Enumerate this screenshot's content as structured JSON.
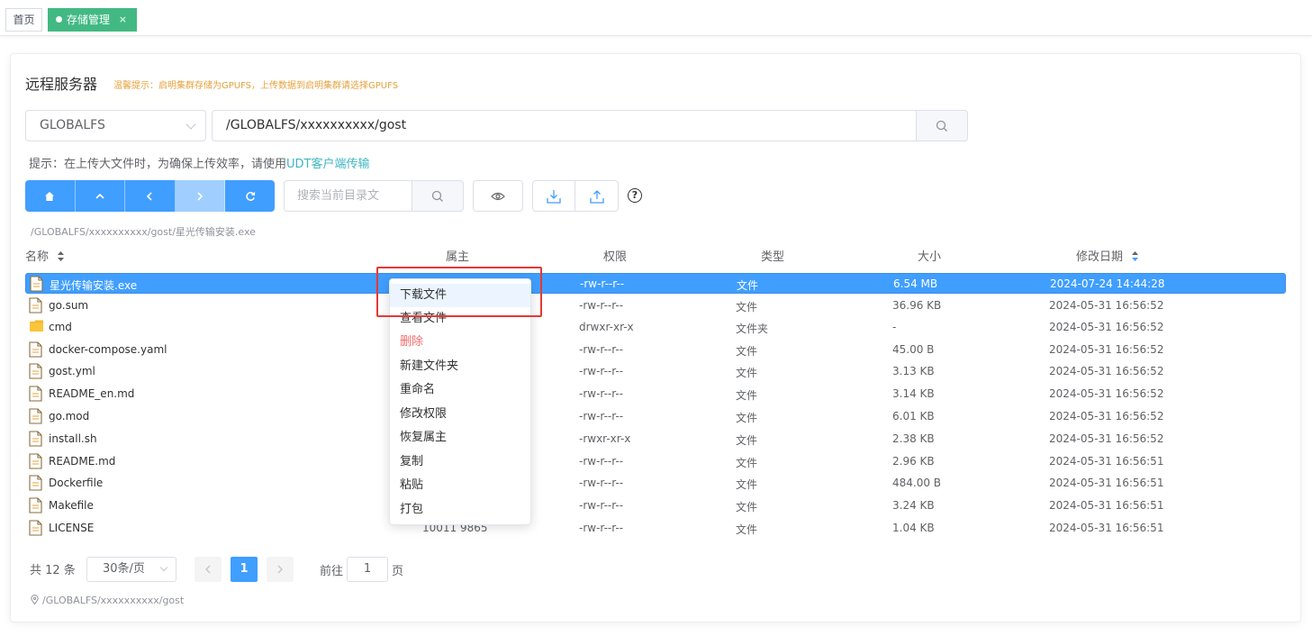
{
  "tabs": {
    "home_label": "首页",
    "active_label": "存储管理",
    "close_glyph": "×"
  },
  "panel": {
    "title": "远程服务器",
    "warning": "温馨提示：启明集群存储为GPUFS，上传数据到启明集群请选择GPUFS"
  },
  "pathbar": {
    "filesystem": "GLOBALFS",
    "path": "/GLOBALFS/xxxxxxxxxx/gost"
  },
  "hint": {
    "prefix": "提示：在上传大文件时，为确保上传效率，请使用",
    "link": "UDT客户端传输"
  },
  "toolbar": {
    "search_placeholder": "搜索当前目录文",
    "help_glyph": "?",
    "icons": [
      "home-icon",
      "arrow-up-icon",
      "arrow-left-icon",
      "arrow-right-icon",
      "refresh-icon",
      "search-icon",
      "eye-icon",
      "download-icon",
      "upload-icon",
      "help-icon"
    ]
  },
  "current_selection_path": "/GLOBALFS/xxxxxxxxxx/gost/星光传输安装.exe",
  "table": {
    "columns": [
      "名称",
      "属主",
      "权限",
      "类型",
      "大小",
      "修改日期"
    ],
    "rows": [
      {
        "name": "星光传输安装.exe",
        "owner": "",
        "perm": "-rw-r--r--",
        "type": "文件",
        "size": "6.54 MB",
        "date": "2024-07-24 14:44:28",
        "icon": "file-icon",
        "selected": true
      },
      {
        "name": "go.sum",
        "owner": "",
        "perm": "-rw-r--r--",
        "type": "文件",
        "size": "36.96 KB",
        "date": "2024-05-31 16:56:52",
        "icon": "file-icon"
      },
      {
        "name": "cmd",
        "owner": "",
        "perm": "drwxr-xr-x",
        "type": "文件夹",
        "size": "-",
        "date": "2024-05-31 16:56:52",
        "icon": "folder-icon"
      },
      {
        "name": "docker-compose.yaml",
        "owner": "",
        "perm": "-rw-r--r--",
        "type": "文件",
        "size": "45.00 B",
        "date": "2024-05-31 16:56:52",
        "icon": "file-icon"
      },
      {
        "name": "gost.yml",
        "owner": "",
        "perm": "-rw-r--r--",
        "type": "文件",
        "size": "3.13 KB",
        "date": "2024-05-31 16:56:52",
        "icon": "file-icon"
      },
      {
        "name": "README_en.md",
        "owner": "",
        "perm": "-rw-r--r--",
        "type": "文件",
        "size": "3.14 KB",
        "date": "2024-05-31 16:56:52",
        "icon": "file-icon"
      },
      {
        "name": "go.mod",
        "owner": "",
        "perm": "-rw-r--r--",
        "type": "文件",
        "size": "6.01 KB",
        "date": "2024-05-31 16:56:52",
        "icon": "file-icon"
      },
      {
        "name": "install.sh",
        "owner": "",
        "perm": "-rwxr-xr-x",
        "type": "文件",
        "size": "2.38 KB",
        "date": "2024-05-31 16:56:52",
        "icon": "file-icon"
      },
      {
        "name": "README.md",
        "owner": "",
        "perm": "-rw-r--r--",
        "type": "文件",
        "size": "2.96 KB",
        "date": "2024-05-31 16:56:51",
        "icon": "file-icon"
      },
      {
        "name": "Dockerfile",
        "owner": "",
        "perm": "-rw-r--r--",
        "type": "文件",
        "size": "484.00 B",
        "date": "2024-05-31 16:56:51",
        "icon": "file-icon"
      },
      {
        "name": "Makefile",
        "owner": "",
        "perm": "-rw-r--r--",
        "type": "文件",
        "size": "3.24 KB",
        "date": "2024-05-31 16:56:51",
        "icon": "file-icon"
      },
      {
        "name": "LICENSE",
        "owner": "10011 9865",
        "perm": "-rw-r--r--",
        "type": "文件",
        "size": "1.04 KB",
        "date": "2024-05-31 16:56:51",
        "icon": "file-icon"
      }
    ]
  },
  "pagination": {
    "total": "共 12 条",
    "page_size": "30条/页",
    "current_page": "1",
    "goto_prefix": "前往",
    "goto_value": "1",
    "goto_suffix": "页"
  },
  "footer_path": "/GLOBALFS/xxxxxxxxxx/gost",
  "context_menu": {
    "items": [
      "下载文件",
      "查看文件",
      "删除",
      "新建文件夹",
      "重命名",
      "修改权限",
      "恢复属主",
      "复制",
      "粘贴",
      "打包"
    ],
    "hovered_index": 0,
    "danger_index": 2
  },
  "colors": {
    "primary": "#409eff",
    "tab_active": "#42b983",
    "warning": "#e6a23c",
    "danger": "#f56c6c",
    "link": "#3cb5c4",
    "highlight_box": "#e53935"
  }
}
